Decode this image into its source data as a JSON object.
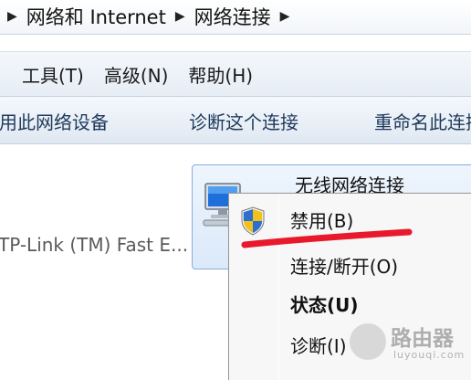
{
  "breadcrumb": {
    "separator_icon": "chevron-right-icon",
    "items": [
      "网络和 Internet",
      "网络连接"
    ]
  },
  "menubar": {
    "items": [
      "工具(T)",
      "高级(N)",
      "帮助(H)"
    ]
  },
  "commandbar": {
    "items": [
      "禁用此网络设备",
      "诊断这个连接",
      "重命名此连接"
    ]
  },
  "connections": {
    "left_item_label": "TP-Link (TM) Fast E...",
    "wireless_title": "无线网络连接"
  },
  "context_menu": {
    "items": [
      {
        "label": "禁用(B)",
        "icon": "uac-shield-icon"
      },
      {
        "label": "连接/断开(O)"
      },
      {
        "label": "状态(U)",
        "bold": true
      },
      {
        "label": "诊断(I)"
      }
    ]
  },
  "watermark": {
    "text": "路由器",
    "subtext": "luyouqi.com"
  },
  "colors": {
    "annotation_red": "#e8192c",
    "selection_blue": "#86aee0"
  }
}
